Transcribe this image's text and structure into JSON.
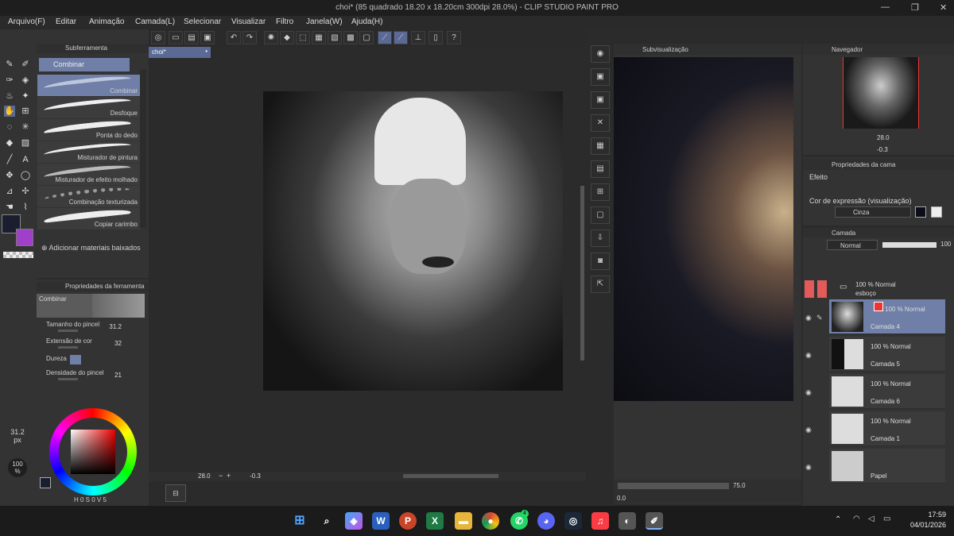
{
  "title": "choi* (85 quadrado 18.20 x 18.20cm 300dpi 28.0%) - CLIP STUDIO PAINT PRO",
  "menu": [
    "Arquivo(F)",
    "Editar",
    "Animação",
    "Camada(L)",
    "Selecionar",
    "Visualizar",
    "Filtro",
    "Janela(W)",
    "Ajuda(H)"
  ],
  "subtool": {
    "header": "Subferramenta",
    "group": "Combinar",
    "items": [
      "Combinar",
      "Desfoque",
      "Ponta do dedo",
      "Misturador de pintura",
      "Misturador de efeito molhado",
      "Combinação texturizada",
      "Copiar carimbo"
    ],
    "add_materials": "Adicionar materiais baixados"
  },
  "tool_props": {
    "header": "Propriedades da ferramenta",
    "name": "Combinar",
    "brush_size_label": "Tamanho do pincel",
    "brush_size": "31.2",
    "color_ext_label": "Extensão de cor",
    "color_ext": "32",
    "hardness_label": "Dureza",
    "density_label": "Densidade do pincel",
    "density": "21"
  },
  "left_readouts": {
    "size": "31.2",
    "size_unit": "px",
    "opacity": "100",
    "opacity_unit": "%"
  },
  "color_readout": {
    "h": "0",
    "s": "0",
    "v": "5"
  },
  "canvas": {
    "tab": "choi*",
    "zoom": "28.0",
    "angle": "-0.3"
  },
  "subview": {
    "header": "Subvisualização",
    "zoom": "75.0",
    "angle": "0.0"
  },
  "navigator": {
    "header": "Navegador",
    "zoom": "28.0",
    "angle": "-0.3"
  },
  "layer_props": {
    "header": "Propriedades da cama",
    "effect": "Efeito",
    "expr_label": "Cor de expressão (visualização)",
    "expr_value": "Cinza"
  },
  "layers_panel": {
    "header": "Camada",
    "blend": "Normal",
    "opacity": "100",
    "folder": {
      "blend": "100 % Normal",
      "name": "esboço"
    },
    "layers": [
      {
        "blend": "100 % Normal",
        "name": "Camada 4"
      },
      {
        "blend": "100 % Normal",
        "name": "Camada 5"
      },
      {
        "blend": "100 % Normal",
        "name": "Camada 6"
      },
      {
        "blend": "100 % Normal",
        "name": "Camada 1"
      },
      {
        "blend": "",
        "name": "Papel"
      }
    ]
  },
  "taskbar": {
    "time": "17:59",
    "date": "04/01/2026",
    "whatsapp_badge": "4"
  },
  "colors": {
    "accent": "#6f7fa8",
    "main_color": "#1a1e2e",
    "sub_color": "#a040c8"
  }
}
